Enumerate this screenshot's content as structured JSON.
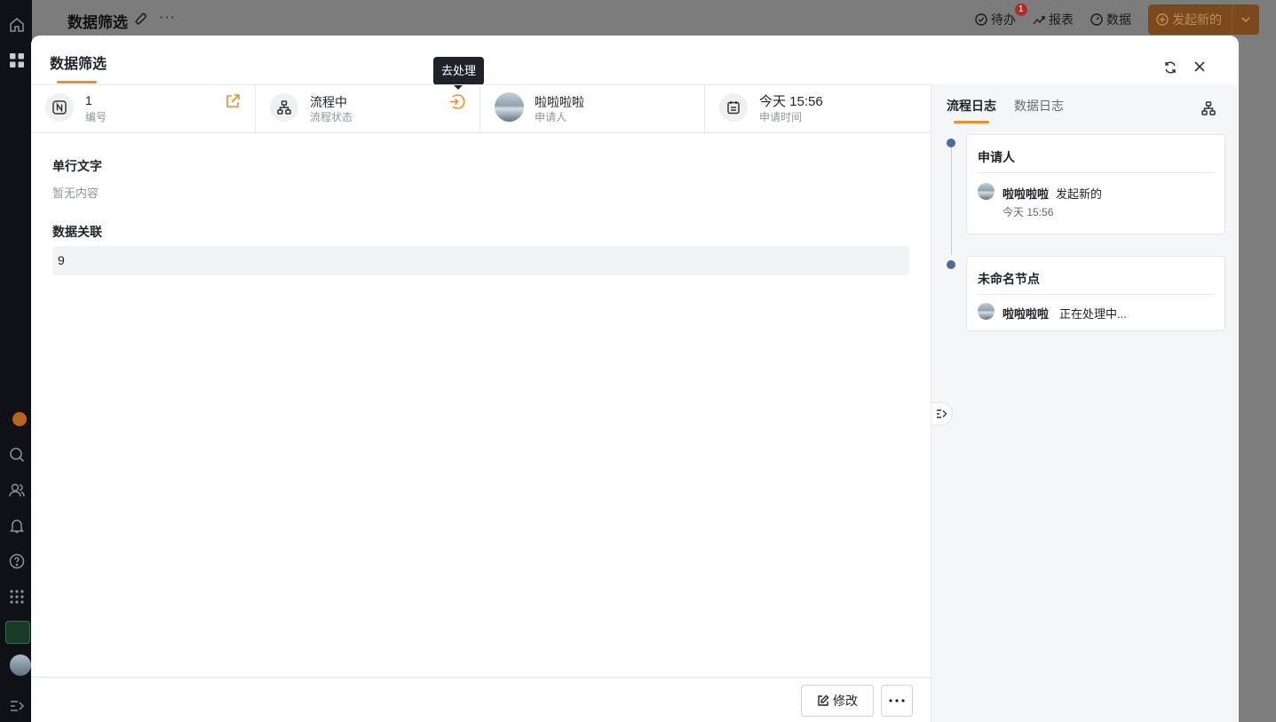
{
  "app": {
    "page_title": "数据筛选",
    "todo_label": "待办",
    "todo_badge": "1",
    "report_label": "报表",
    "data_label": "数据",
    "launch_label": "发起新的"
  },
  "modal": {
    "title": "数据筛选",
    "tooltip": "去处理",
    "cards": [
      {
        "value": "1",
        "label": "编号",
        "icon": "number-icon",
        "action_icon": "open-external-icon"
      },
      {
        "value": "流程中",
        "label": "流程状态",
        "icon": "flow-icon",
        "action_icon": "process-enter-icon"
      },
      {
        "value": "啦啦啦啦",
        "label": "申请人",
        "icon": "avatar"
      },
      {
        "value": "今天 15:56",
        "label": "申请时间",
        "icon": "calendar-icon"
      }
    ],
    "fields": [
      {
        "label": "单行文字",
        "value": "暂无内容"
      },
      {
        "label": "数据关联",
        "value": "9"
      }
    ],
    "edit_label": "修改",
    "colors": {
      "accent": "#f08c2a",
      "timeline_dot": "#4e6a9a"
    }
  },
  "log_panel": {
    "tabs": [
      "流程日志",
      "数据日志"
    ],
    "entries": [
      {
        "node": "申请人",
        "user": "啦啦啦啦",
        "action": "发起新的",
        "time": "今天 15:56"
      },
      {
        "node": "未命名节点",
        "user": "啦啦啦啦",
        "action": "正在处理中..."
      }
    ]
  }
}
